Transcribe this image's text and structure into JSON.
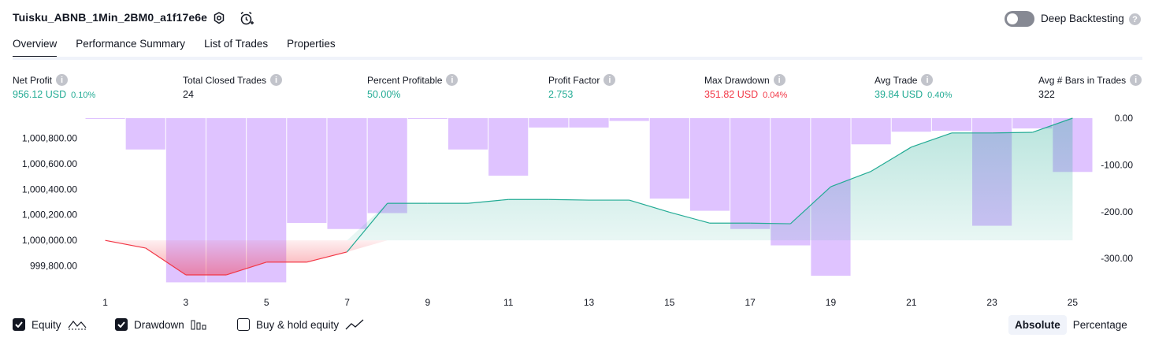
{
  "header": {
    "title": "Tuisku_ABNB_1Min_2BM0_a1f17e6e",
    "settings_icon": "gear-icon",
    "alert_icon": "alarm-clock-plus-icon",
    "deep_backtesting_label": "Deep Backtesting",
    "deep_backtesting_enabled": false
  },
  "tabs": [
    "Overview",
    "Performance Summary",
    "List of Trades",
    "Properties"
  ],
  "active_tab": "Overview",
  "metrics": {
    "net_profit": {
      "label": "Net Profit",
      "value": "956.12 USD",
      "pct": "0.10%"
    },
    "total_closed_trades": {
      "label": "Total Closed Trades",
      "value": "24"
    },
    "percent_profitable": {
      "label": "Percent Profitable",
      "value": "50.00%"
    },
    "profit_factor": {
      "label": "Profit Factor",
      "value": "2.753"
    },
    "max_drawdown": {
      "label": "Max Drawdown",
      "value": "351.82 USD",
      "pct": "0.04%"
    },
    "avg_trade": {
      "label": "Avg Trade",
      "value": "39.84 USD",
      "pct": "0.40%"
    },
    "avg_bars": {
      "label": "Avg # Bars in Trades",
      "value": "322"
    }
  },
  "colors": {
    "profit": "#22ab94",
    "loss": "#f23645",
    "drawdown_bar": "#d9b8ff",
    "equity_line_up": "#22ab94",
    "equity_line_down": "#f23645"
  },
  "chart_data": {
    "type": "line",
    "x": [
      1,
      2,
      3,
      4,
      5,
      6,
      7,
      8,
      9,
      10,
      11,
      12,
      13,
      14,
      15,
      16,
      17,
      18,
      19,
      20,
      21,
      22,
      23,
      24,
      25
    ],
    "x_ticks": [
      "1",
      "3",
      "5",
      "7",
      "9",
      "11",
      "13",
      "15",
      "17",
      "19",
      "21",
      "23",
      "25"
    ],
    "series": [
      {
        "type": "line",
        "axis": "left",
        "values": [
          1000000,
          999940,
          999730,
          999730,
          999830,
          999830,
          999910,
          1000290,
          1000290,
          1000290,
          1000320,
          1000320,
          1000315,
          1000315,
          1000220,
          1000135,
          1000135,
          1000130,
          1000420,
          1000540,
          1000730,
          1000840,
          1000840,
          1000845,
          1000956
        ]
      },
      {
        "type": "bar",
        "axis": "right",
        "values": [
          -1,
          -67,
          -351,
          -351,
          -351,
          -224,
          -237,
          -203,
          0,
          -67,
          -123,
          -20,
          -20,
          -6,
          -172,
          -198,
          -237,
          -272,
          -337,
          -56,
          -29,
          -27,
          -230,
          -22,
          -115
        ]
      }
    ],
    "y_left_ticks": [
      "1,000,800.00",
      "1,000,600.00",
      "1,000,400.00",
      "1,000,200.00",
      "1,000,000.00",
      "999,800.00"
    ],
    "y_left_range": [
      999650,
      1000956
    ],
    "y_right_ticks": [
      "0.00",
      "-100.00",
      "-200.00",
      "-300.00"
    ],
    "y_right_range": [
      -357,
      0
    ]
  },
  "legend": {
    "equity": {
      "label": "Equity",
      "checked": true
    },
    "drawdown": {
      "label": "Drawdown",
      "checked": true
    },
    "buy_hold": {
      "label": "Buy & hold equity",
      "checked": false
    }
  },
  "view_mode": {
    "options": [
      "Absolute",
      "Percentage"
    ],
    "selected": "Absolute"
  }
}
